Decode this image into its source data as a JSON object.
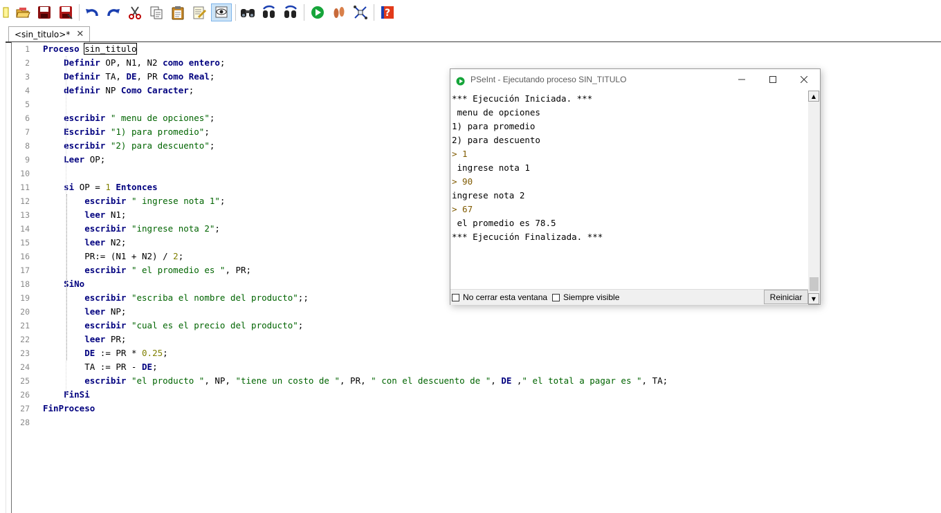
{
  "toolbar": {
    "icons": [
      "new-file-icon",
      "open-file-icon",
      "save-icon",
      "save-as-icon",
      "undo-icon",
      "redo-icon",
      "cut-icon",
      "copy-icon",
      "paste-icon",
      "edit-icon",
      "debug-icon",
      "search-icon",
      "search-previous-icon",
      "search-next-icon",
      "run-icon",
      "step-by-step-icon",
      "flowchart-icon",
      "help-icon"
    ]
  },
  "tab": {
    "label": "<sin_titulo>*",
    "close": "✕"
  },
  "editor": {
    "line_numbers": [
      "1",
      "2",
      "3",
      "4",
      "5",
      "6",
      "7",
      "8",
      "9",
      "10",
      "11",
      "12",
      "13",
      "14",
      "15",
      "16",
      "17",
      "18",
      "19",
      "20",
      "21",
      "22",
      "23",
      "24",
      "25",
      "26",
      "27",
      "28"
    ],
    "lines": [
      [
        {
          "t": "kw",
          "v": "Proceso"
        },
        {
          "t": "plain",
          "v": " "
        },
        {
          "t": "hl",
          "v": "sin_titulo"
        }
      ],
      [
        {
          "t": "plain",
          "v": "    "
        },
        {
          "t": "kw",
          "v": "Definir"
        },
        {
          "t": "plain",
          "v": " OP, N1, N2 "
        },
        {
          "t": "kw",
          "v": "como entero"
        },
        {
          "t": "plain",
          "v": ";"
        }
      ],
      [
        {
          "t": "plain",
          "v": "    "
        },
        {
          "t": "kw",
          "v": "Definir"
        },
        {
          "t": "plain",
          "v": " TA, "
        },
        {
          "t": "kw",
          "v": "DE"
        },
        {
          "t": "plain",
          "v": ", PR "
        },
        {
          "t": "kw",
          "v": "Como Real"
        },
        {
          "t": "plain",
          "v": ";"
        }
      ],
      [
        {
          "t": "plain",
          "v": "    "
        },
        {
          "t": "kw",
          "v": "definir"
        },
        {
          "t": "plain",
          "v": " NP "
        },
        {
          "t": "kw",
          "v": "Como Caracter"
        },
        {
          "t": "plain",
          "v": ";"
        }
      ],
      [],
      [
        {
          "t": "plain",
          "v": "    "
        },
        {
          "t": "kw",
          "v": "escribir"
        },
        {
          "t": "plain",
          "v": " "
        },
        {
          "t": "str",
          "v": "\" menu de opciones\""
        },
        {
          "t": "plain",
          "v": ";"
        }
      ],
      [
        {
          "t": "plain",
          "v": "    "
        },
        {
          "t": "kw",
          "v": "Escribir"
        },
        {
          "t": "plain",
          "v": " "
        },
        {
          "t": "str",
          "v": "\"1) para promedio\""
        },
        {
          "t": "plain",
          "v": ";"
        }
      ],
      [
        {
          "t": "plain",
          "v": "    "
        },
        {
          "t": "kw",
          "v": "escribir"
        },
        {
          "t": "plain",
          "v": " "
        },
        {
          "t": "str",
          "v": "\"2) para descuento\""
        },
        {
          "t": "plain",
          "v": ";"
        }
      ],
      [
        {
          "t": "plain",
          "v": "    "
        },
        {
          "t": "kw",
          "v": "Leer"
        },
        {
          "t": "plain",
          "v": " OP;"
        }
      ],
      [],
      [
        {
          "t": "plain",
          "v": "    "
        },
        {
          "t": "kw",
          "v": "si"
        },
        {
          "t": "plain",
          "v": " OP = "
        },
        {
          "t": "num",
          "v": "1"
        },
        {
          "t": "plain",
          "v": " "
        },
        {
          "t": "kw",
          "v": "Entonces"
        }
      ],
      [
        {
          "t": "plain",
          "v": "        "
        },
        {
          "t": "kw",
          "v": "escribir"
        },
        {
          "t": "plain",
          "v": " "
        },
        {
          "t": "str",
          "v": "\" ingrese nota 1\""
        },
        {
          "t": "plain",
          "v": ";"
        }
      ],
      [
        {
          "t": "plain",
          "v": "        "
        },
        {
          "t": "kw",
          "v": "leer"
        },
        {
          "t": "plain",
          "v": " N1;"
        }
      ],
      [
        {
          "t": "plain",
          "v": "        "
        },
        {
          "t": "kw",
          "v": "escribir"
        },
        {
          "t": "plain",
          "v": " "
        },
        {
          "t": "str",
          "v": "\"ingrese nota 2\""
        },
        {
          "t": "plain",
          "v": ";"
        }
      ],
      [
        {
          "t": "plain",
          "v": "        "
        },
        {
          "t": "kw",
          "v": "leer"
        },
        {
          "t": "plain",
          "v": " N2;"
        }
      ],
      [
        {
          "t": "plain",
          "v": "        PR:= (N1 + N2) / "
        },
        {
          "t": "num",
          "v": "2"
        },
        {
          "t": "plain",
          "v": ";"
        }
      ],
      [
        {
          "t": "plain",
          "v": "        "
        },
        {
          "t": "kw",
          "v": "escribir"
        },
        {
          "t": "plain",
          "v": " "
        },
        {
          "t": "str",
          "v": "\" el promedio es \""
        },
        {
          "t": "plain",
          "v": ", PR;"
        }
      ],
      [
        {
          "t": "plain",
          "v": "    "
        },
        {
          "t": "kw",
          "v": "SiNo"
        }
      ],
      [
        {
          "t": "plain",
          "v": "        "
        },
        {
          "t": "kw",
          "v": "escribir"
        },
        {
          "t": "plain",
          "v": " "
        },
        {
          "t": "str",
          "v": "\"escriba el nombre del producto\""
        },
        {
          "t": "plain",
          "v": ";;"
        }
      ],
      [
        {
          "t": "plain",
          "v": "        "
        },
        {
          "t": "kw",
          "v": "leer"
        },
        {
          "t": "plain",
          "v": " NP;"
        }
      ],
      [
        {
          "t": "plain",
          "v": "        "
        },
        {
          "t": "kw",
          "v": "escribir"
        },
        {
          "t": "plain",
          "v": " "
        },
        {
          "t": "str",
          "v": "\"cual es el precio del producto\""
        },
        {
          "t": "plain",
          "v": ";"
        }
      ],
      [
        {
          "t": "plain",
          "v": "        "
        },
        {
          "t": "kw",
          "v": "leer"
        },
        {
          "t": "plain",
          "v": " PR;"
        }
      ],
      [
        {
          "t": "plain",
          "v": "        "
        },
        {
          "t": "kw",
          "v": "DE"
        },
        {
          "t": "plain",
          "v": " := PR * "
        },
        {
          "t": "num",
          "v": "0.25"
        },
        {
          "t": "plain",
          "v": ";"
        }
      ],
      [
        {
          "t": "plain",
          "v": "        TA := PR - "
        },
        {
          "t": "kw",
          "v": "DE"
        },
        {
          "t": "plain",
          "v": ";"
        }
      ],
      [
        {
          "t": "plain",
          "v": "        "
        },
        {
          "t": "kw",
          "v": "escribir"
        },
        {
          "t": "plain",
          "v": " "
        },
        {
          "t": "str",
          "v": "\"el producto \""
        },
        {
          "t": "plain",
          "v": ", NP, "
        },
        {
          "t": "str",
          "v": "\"tiene un costo de \""
        },
        {
          "t": "plain",
          "v": ", PR, "
        },
        {
          "t": "str",
          "v": "\" con el descuento de \""
        },
        {
          "t": "plain",
          "v": ", "
        },
        {
          "t": "kw",
          "v": "DE"
        },
        {
          "t": "plain",
          "v": " ,"
        },
        {
          "t": "str",
          "v": "\" el total a pagar es \""
        },
        {
          "t": "plain",
          "v": ", TA;"
        }
      ],
      [
        {
          "t": "plain",
          "v": "    "
        },
        {
          "t": "kw",
          "v": "FinSi"
        }
      ],
      [
        {
          "t": "kw",
          "v": "FinProceso"
        }
      ],
      []
    ]
  },
  "console": {
    "title": "PSeInt - Ejecutando proceso SIN_TITULO",
    "output": [
      {
        "type": "info",
        "text": "*** Ejecución Iniciada. ***"
      },
      {
        "type": "out",
        "text": " menu de opciones"
      },
      {
        "type": "out",
        "text": "1) para promedio"
      },
      {
        "type": "out",
        "text": "2) para descuento"
      },
      {
        "type": "input",
        "text": "> 1"
      },
      {
        "type": "out",
        "text": " ingrese nota 1"
      },
      {
        "type": "input",
        "text": "> 90"
      },
      {
        "type": "out",
        "text": "ingrese nota 2"
      },
      {
        "type": "input",
        "text": "> 67"
      },
      {
        "type": "out",
        "text": " el promedio es 78.5"
      },
      {
        "type": "info",
        "text": "*** Ejecución Finalizada. ***"
      }
    ],
    "no_cerrar_label": "No cerrar esta ventana",
    "siempre_visible_label": "Siempre visible",
    "reiniciar_label": "Reiniciar"
  }
}
